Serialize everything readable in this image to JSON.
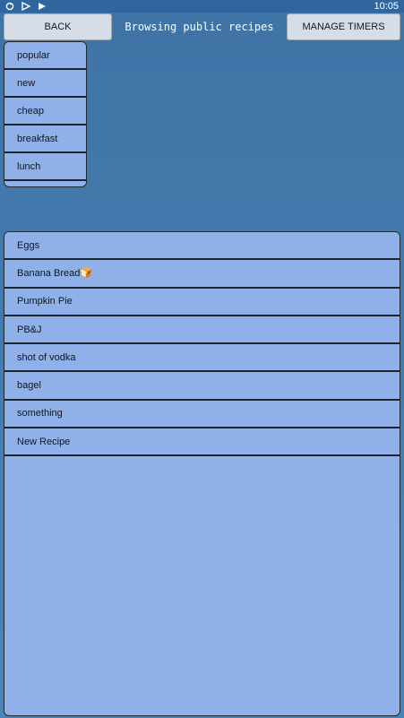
{
  "status_bar": {
    "time": "10:05",
    "icons": [
      "sync-icon",
      "signal-icon",
      "play-store-icon"
    ]
  },
  "header": {
    "back_label": "BACK",
    "title": "Browsing public recipes",
    "timers_label": "MANAGE TIMERS"
  },
  "tags": [
    {
      "label": "popular"
    },
    {
      "label": "new"
    },
    {
      "label": "cheap"
    },
    {
      "label": "breakfast"
    },
    {
      "label": "lunch"
    }
  ],
  "recipes": [
    {
      "label": "Eggs"
    },
    {
      "label": "Banana Bread🍞"
    },
    {
      "label": "Pumpkin Pie"
    },
    {
      "label": "PB&J"
    },
    {
      "label": "shot of vodka"
    },
    {
      "label": "bagel"
    },
    {
      "label": "something"
    },
    {
      "label": "New Recipe"
    }
  ],
  "colors": {
    "background": "#4a84b6",
    "list_fill": "#8fb0e8",
    "button_fill": "#d7dde6",
    "status_bar": "#2f66a0"
  }
}
